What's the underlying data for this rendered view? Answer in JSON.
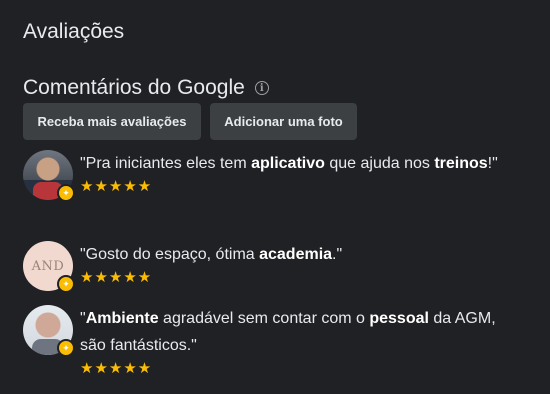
{
  "section": {
    "title": "Avaliações"
  },
  "google_reviews": {
    "title": "Comentários do Google",
    "info_icon": "info-icon"
  },
  "buttons": {
    "get_reviews": "Receba mais avaliações",
    "add_photo": "Adicionar uma foto"
  },
  "reviews": [
    {
      "avatar": "man-red-shirt-photo",
      "parts": [
        "\"Pra iniciantes eles tem ",
        "aplicativo",
        " que ajuda nos ",
        "treinos",
        "!\""
      ],
      "stars": "★★★★★",
      "rating": 5
    },
    {
      "avatar_text": "AND",
      "parts": [
        "\"Gosto do espaço, ótima ",
        "academia",
        ".\""
      ],
      "stars": "★★★★★",
      "rating": 5
    },
    {
      "avatar": "man-grey-shirt-photo",
      "parts": [
        "\"",
        "Ambiente",
        " agradável sem contar com o ",
        "pessoal",
        " da AGM, são fantásticos.\""
      ],
      "stars": "★★★★★",
      "rating": 5
    }
  ],
  "colors": {
    "background": "#202124",
    "star": "#fbbc04",
    "button_bg": "#3c4043"
  }
}
